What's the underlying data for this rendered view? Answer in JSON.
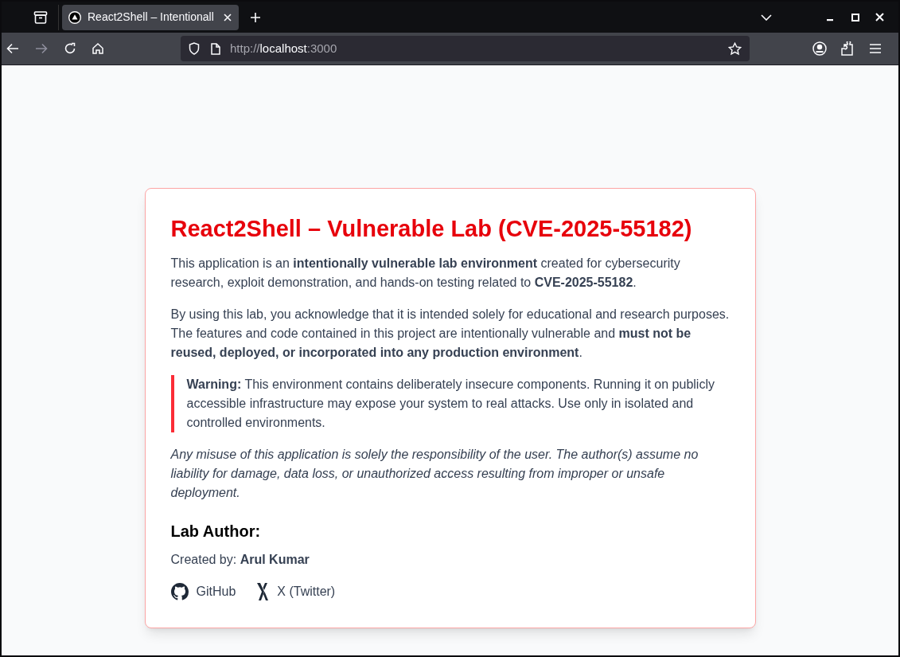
{
  "browser": {
    "tab": {
      "title": "React2Shell – Intentionall",
      "selected": true
    },
    "url": {
      "scheme": "http://",
      "host": "localhost",
      "port": ":3000"
    }
  },
  "card": {
    "title": "React2Shell – Vulnerable Lab (CVE-2025-55182)",
    "blocks": [
      {
        "kind": "paragraph",
        "text": "This application is an **intentionally vulnerable lab environment** created for cybersecurity research, exploit demonstration, and hands-on testing related to **CVE-2025-55182**."
      },
      {
        "kind": "paragraph",
        "text": "By using this lab, you acknowledge that it is intended solely for educational and research purposes. The features and code contained in this project are intentionally vulnerable and **must not be reused, deployed, or incorporated into any production environment**."
      },
      {
        "kind": "warning",
        "text": "**Warning:** This environment contains deliberately insecure components. Running it on publicly accessible infrastructure may expose your system to real attacks. Use only in isolated and controlled environments."
      },
      {
        "kind": "disclaimer",
        "text": "Any misuse of this application is solely the responsibility of the user. The author(s) assume no liability for damage, data loss, or unauthorized access resulting from improper or unsafe deployment."
      }
    ],
    "author_heading": "Lab Author:",
    "created_by": "Created by: **Arul Kumar**",
    "links": [
      {
        "kind": "github",
        "label": "GitHub"
      },
      {
        "kind": "x",
        "label": "X (Twitter)"
      }
    ]
  }
}
